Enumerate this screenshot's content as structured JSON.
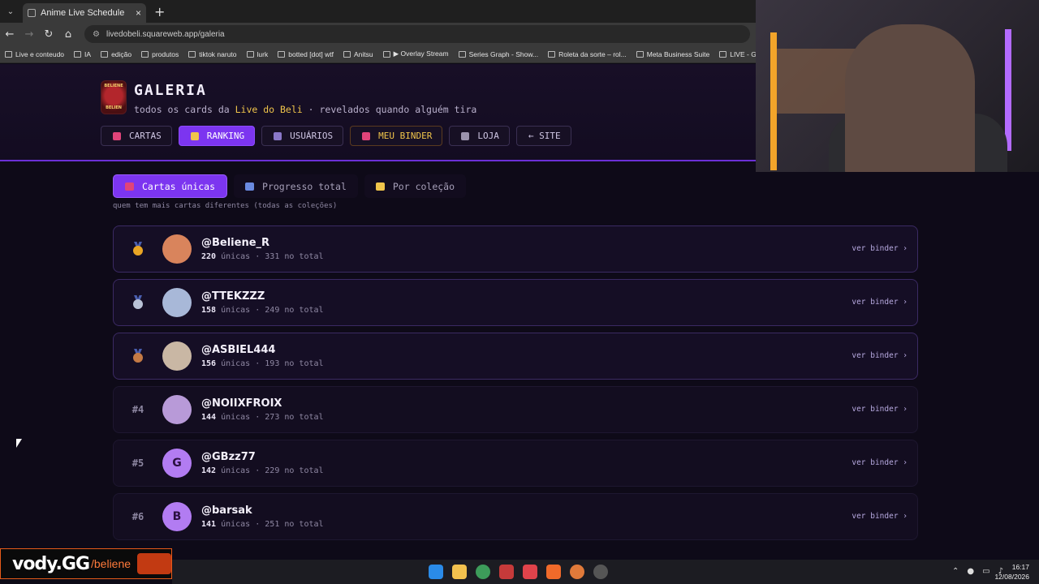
{
  "browser": {
    "tab_title": "Anime Live Schedule",
    "url": "livedobeli.squareweb.app/galeria",
    "bookmarks": [
      "Live e conteudo",
      "IA",
      "edição",
      "produtos",
      "tiktok naruto",
      "lurk",
      "botted [dot] wtf",
      "Anitsu",
      "▶ Overlay Stream",
      "Series Graph - Show...",
      "Roleta da sorte – rol...",
      "Meta Business Suite",
      "LIVE - Goog"
    ]
  },
  "header": {
    "logo_top": "BELIENE",
    "logo_bottom": "BELIEN",
    "title": "GALERIA",
    "subtitle_pre": "todos os cards da ",
    "subtitle_highlight": "Live do Beli",
    "subtitle_post": " · revelados quando alguém tira"
  },
  "nav": [
    {
      "label": "CARTAS",
      "icon": "card-icon",
      "active": false
    },
    {
      "label": "RANKING",
      "icon": "trophy-icon",
      "active": true
    },
    {
      "label": "USUÁRIOS",
      "icon": "users-icon",
      "active": false
    },
    {
      "label": "MEU BINDER",
      "icon": "binder-icon",
      "active": false
    },
    {
      "label": "LOJA",
      "icon": "cart-icon",
      "active": false
    },
    {
      "label": "← SITE",
      "icon": "",
      "active": false
    }
  ],
  "subtabs": [
    {
      "label": "Cartas únicas",
      "icon": "card-icon",
      "active": true
    },
    {
      "label": "Progresso total",
      "icon": "chart-icon",
      "active": false
    },
    {
      "label": "Por coleção",
      "icon": "folder-icon",
      "active": false
    }
  ],
  "subtab_description": "quem tem mais cartas diferentes (todas as coleções)",
  "ranking": [
    {
      "rank": "",
      "medal": "gold",
      "user": "@Beliene_R",
      "unique": "220",
      "unique_label": " únicas · ",
      "total": "331 no total",
      "initial": "",
      "avatar_color": "#d9845c"
    },
    {
      "rank": "",
      "medal": "silver",
      "user": "@TTEKZZZ",
      "unique": "158",
      "unique_label": " únicas · ",
      "total": "249 no total",
      "initial": "",
      "avatar_color": "#a8b8d8"
    },
    {
      "rank": "",
      "medal": "bronze",
      "user": "@ASBIEL444",
      "unique": "156",
      "unique_label": " únicas · ",
      "total": "193 no total",
      "initial": "",
      "avatar_color": "#c9b7a4"
    },
    {
      "rank": "#4",
      "medal": "",
      "user": "@NOIIXFROIX",
      "unique": "144",
      "unique_label": " únicas · ",
      "total": "273 no total",
      "initial": "",
      "avatar_color": "#b89ad8"
    },
    {
      "rank": "#5",
      "medal": "",
      "user": "@GBzz77",
      "unique": "142",
      "unique_label": " únicas · ",
      "total": "229 no total",
      "initial": "G",
      "avatar_color": "#b27cf2"
    },
    {
      "rank": "#6",
      "medal": "",
      "user": "@barsak",
      "unique": "141",
      "unique_label": " únicas · ",
      "total": "251 no total",
      "initial": "B",
      "avatar_color": "#b27cf2"
    }
  ],
  "row_action": "ver binder ›",
  "overlay": {
    "brand": "vody.GG",
    "slug": "/beliene"
  },
  "taskbar": {
    "time": "16:17",
    "date": "12/08/2026"
  },
  "colors": {
    "accent": "#7c35f0",
    "gold": "#f0c54b",
    "bg": "#0e0a18"
  }
}
